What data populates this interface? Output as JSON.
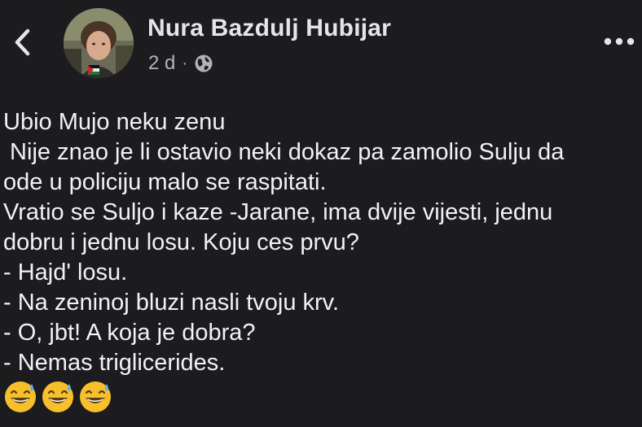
{
  "post": {
    "author": "Nura Bazdulj Hubijar",
    "time": "2 d",
    "separator": "·",
    "audience_icon": "globe-icon",
    "lines": [
      "Ubio Mujo neku zenu",
      " Nije znao je li ostavio neki dokaz pa zamolio Sulju da",
      "ode u policiju malo se raspitati.",
      "Vratio se Suljo i kaze -Jarane, ima dvije vijesti, jednu",
      "dobru i jednu losu. Koju ces prvu?",
      "- Hajd' losu.",
      "- Na zeninoj bluzi nasli tvoju krv.",
      "- O, jbt! A koja je dobra?",
      "- Nemas triglicerides."
    ],
    "emojis": [
      "grinning-sweat-emoji",
      "grinning-sweat-emoji",
      "grinning-sweat-emoji"
    ]
  },
  "header": {
    "back_icon": "chevron-left-icon",
    "more_icon": "more-horizontal-icon"
  },
  "colors": {
    "background": "#1c1c1e",
    "text_primary": "#e4e6eb",
    "text_secondary": "#b0b3b8"
  }
}
